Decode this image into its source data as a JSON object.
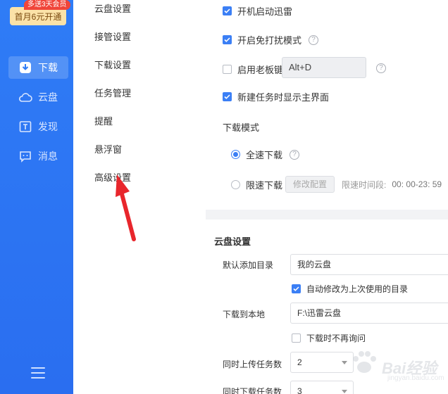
{
  "promo": {
    "badge": "多送3天会员",
    "label": "首月6元开通"
  },
  "rail": {
    "items": [
      {
        "label": "下载",
        "icon": "download-icon",
        "active": true
      },
      {
        "label": "云盘",
        "icon": "cloud-icon",
        "active": false
      },
      {
        "label": "发现",
        "icon": "discover-icon",
        "active": false
      },
      {
        "label": "消息",
        "icon": "message-icon",
        "active": false
      }
    ],
    "menu_icon": "hamburger-menu-icon"
  },
  "settings_nav": {
    "items": [
      "云盘设置",
      "接管设置",
      "下载设置",
      "任务管理",
      "提醒",
      "悬浮窗",
      "高级设置"
    ]
  },
  "general": {
    "autostart": {
      "label": "开机启动迅雷",
      "checked": true
    },
    "dnd": {
      "label": "开启免打扰模式",
      "checked": true
    },
    "boss_key": {
      "label": "启用老板键",
      "checked": false,
      "hotkey": "Alt+D"
    },
    "show_main": {
      "label": "新建任务时显示主界面",
      "checked": true
    },
    "download_mode_title": "下载模式",
    "mode_full": {
      "label": "全速下载",
      "selected": true
    },
    "mode_limit": {
      "label": "限速下载",
      "selected": false,
      "button": "修改配置",
      "period_label": "限速时间段:",
      "period_value": "00: 00-23: 59"
    }
  },
  "cloud": {
    "title": "云盘设置",
    "default_dir_label": "默认添加目录",
    "default_dir_value": "我的云盘",
    "auto_modify": {
      "label": "自动修改为上次使用的目录",
      "checked": true
    },
    "local_label": "下载到本地",
    "local_value": "F:\\迅雷云盘",
    "no_ask": {
      "label": "下载时不再询问",
      "checked": false
    },
    "upload_label": "同时上传任务数",
    "upload_value": "2",
    "download_label": "同时下载任务数",
    "download_value": "3"
  },
  "watermark": {
    "text": "Bai经验",
    "sub": "jingyan.baidu.com"
  },
  "colors": {
    "accent": "#3b7ff5",
    "rail": "#2f7cf6",
    "arrow": "#e8262c"
  }
}
